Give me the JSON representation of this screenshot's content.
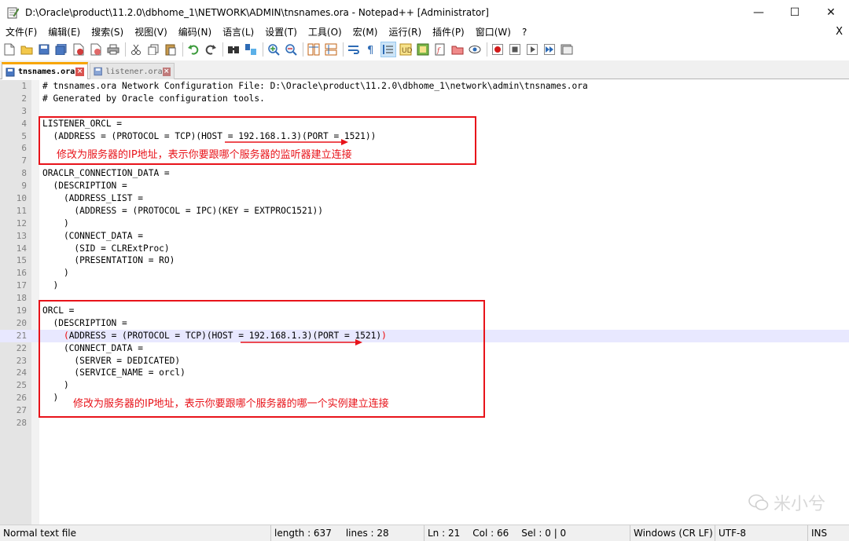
{
  "window": {
    "title": "D:\\Oracle\\product\\11.2.0\\dbhome_1\\NETWORK\\ADMIN\\tnsnames.ora - Notepad++ [Administrator]",
    "minimize": "—",
    "maximize": "☐",
    "close": "✕"
  },
  "menu": {
    "items": [
      "文件(F)",
      "编辑(E)",
      "搜索(S)",
      "视图(V)",
      "编码(N)",
      "语言(L)",
      "设置(T)",
      "工具(O)",
      "宏(M)",
      "运行(R)",
      "插件(P)",
      "窗口(W)",
      "?"
    ],
    "close_doc": "X"
  },
  "toolbar": {
    "icons": [
      "new-file-icon",
      "open-file-icon",
      "save-icon",
      "save-all-icon",
      "close-icon",
      "close-all-icon",
      "print-icon",
      "cut-icon",
      "copy-icon",
      "paste-icon",
      "undo-icon",
      "redo-icon",
      "find-icon",
      "replace-icon",
      "zoom-in-icon",
      "zoom-out-icon",
      "sync-vertical-icon",
      "sync-horizontal-icon",
      "word-wrap-icon",
      "show-all-chars-icon",
      "indent-guide-icon",
      "user-lang-icon",
      "doc-map-icon",
      "function-list-icon",
      "folder-workspace-icon",
      "monitoring-icon",
      "record-macro-icon",
      "stop-record-icon",
      "play-macro-icon",
      "run-macro-multiple-icon",
      "save-macro-icon"
    ],
    "colors": {
      "accent": "#1e7bd4",
      "green": "#3a9a3a",
      "red": "#d23c3c"
    }
  },
  "tabs": [
    {
      "label": "tnsnames.ora",
      "active": true
    },
    {
      "label": "listener.ora",
      "active": false
    }
  ],
  "editor": {
    "current_line": 21,
    "lines": [
      "# tnsnames.ora Network Configuration File: D:\\Oracle\\product\\11.2.0\\dbhome_1\\network\\admin\\tnsnames.ora",
      "# Generated by Oracle configuration tools.",
      "",
      "LISTENER_ORCL =",
      "  (ADDRESS = (PROTOCOL = TCP)(HOST = 192.168.1.3)(PORT = 1521))",
      "",
      "",
      "ORACLR_CONNECTION_DATA =",
      "  (DESCRIPTION =",
      "    (ADDRESS_LIST =",
      "      (ADDRESS = (PROTOCOL = IPC)(KEY = EXTPROC1521))",
      "    )",
      "    (CONNECT_DATA =",
      "      (SID = CLRExtProc)",
      "      (PRESENTATION = RO)",
      "    )",
      "  )",
      "",
      "ORCL =",
      "  (DESCRIPTION =",
      "    (ADDRESS = (PROTOCOL = TCP)(HOST = 192.168.1.3)(PORT = 1521))",
      "    (CONNECT_DATA =",
      "      (SERVER = DEDICATED)",
      "      (SERVICE_NAME = orcl)",
      "    )",
      "  )",
      "",
      ""
    ]
  },
  "annotations": {
    "note1": "修改为服务器的IP地址，表示你要跟哪个服务器的监听器建立连接",
    "note2": "修改为服务器的IP地址，表示你要跟哪个服务器的哪一个实例建立连接",
    "color": "#e8131a"
  },
  "watermark": "米小兮",
  "status": {
    "file_type": "Normal text file",
    "length": "length : 637",
    "lines": "lines : 28",
    "ln": "Ln : 21",
    "col": "Col : 66",
    "sel": "Sel : 0 | 0",
    "eol": "Windows (CR LF)",
    "encoding": "UTF-8",
    "mode": "INS"
  }
}
